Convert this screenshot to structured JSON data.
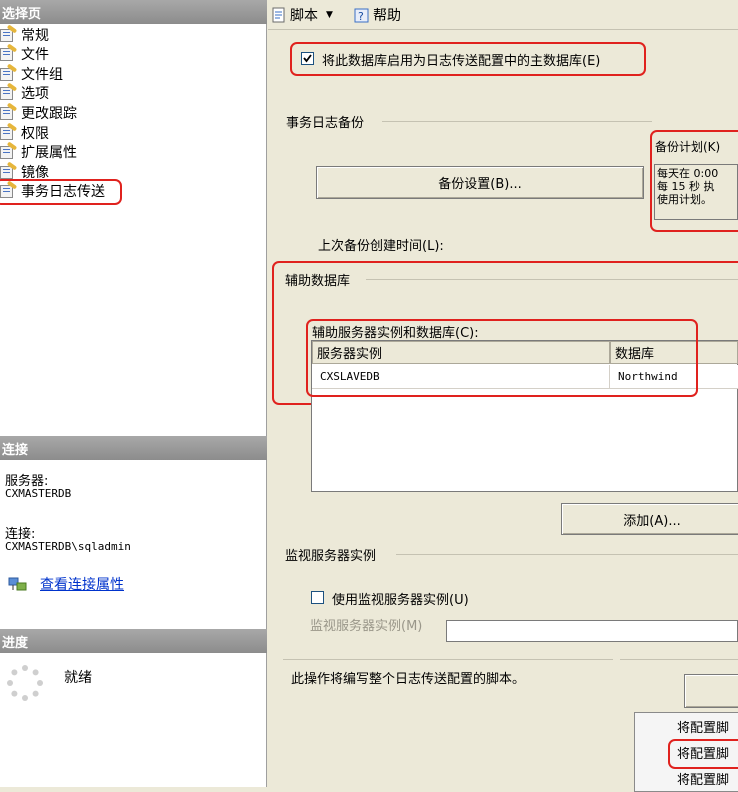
{
  "left": {
    "select_page_header": "选择页",
    "nav_items": [
      {
        "label": "常规"
      },
      {
        "label": "文件"
      },
      {
        "label": "文件组"
      },
      {
        "label": "选项"
      },
      {
        "label": "更改跟踪"
      },
      {
        "label": "权限"
      },
      {
        "label": "扩展属性"
      },
      {
        "label": "镜像"
      },
      {
        "label": "事务日志传送"
      }
    ],
    "connection_header": "连接",
    "server_label": "服务器:",
    "server_value": "CXMASTERDB",
    "connection_label": "连接:",
    "connection_value": "CXMASTERDB\\sqladmin",
    "view_connection_link": "查看连接属性",
    "progress_header": "进度",
    "progress_status": "就绪"
  },
  "toolbar": {
    "script_label": "脚本",
    "help_label": "帮助"
  },
  "main": {
    "enable_primary_checkbox": "将此数据库启用为日志传送配置中的主数据库(E)",
    "enable_primary_checked": true,
    "tlog_backup_group": "事务日志备份",
    "backup_settings_button": "备份设置(B)...",
    "backup_schedule_label": "备份计划(K)",
    "backup_schedule_lines": [
      "每天在 0:00",
      "每 15 秒 执",
      "使用计划。"
    ],
    "last_backup_label": "上次备份创建时间(L):",
    "secondary_db_group": "辅助数据库",
    "secondary_instances_label": "辅助服务器实例和数据库(C):",
    "grid_columns": [
      "服务器实例",
      "数据库"
    ],
    "grid_rows": [
      {
        "server": "CXSLAVEDB",
        "database": "Northwind"
      }
    ],
    "add_button": "添加(A)...",
    "monitor_group": "监视服务器实例",
    "use_monitor_checkbox": "使用监视服务器实例(U)",
    "use_monitor_checked": false,
    "monitor_instance_label": "监视服务器实例(M)",
    "script_note": "此操作将编写整个日志传送配置的脚本。",
    "script_menu_items": [
      "将配置脚",
      "将配置脚",
      "将配置脚"
    ]
  }
}
